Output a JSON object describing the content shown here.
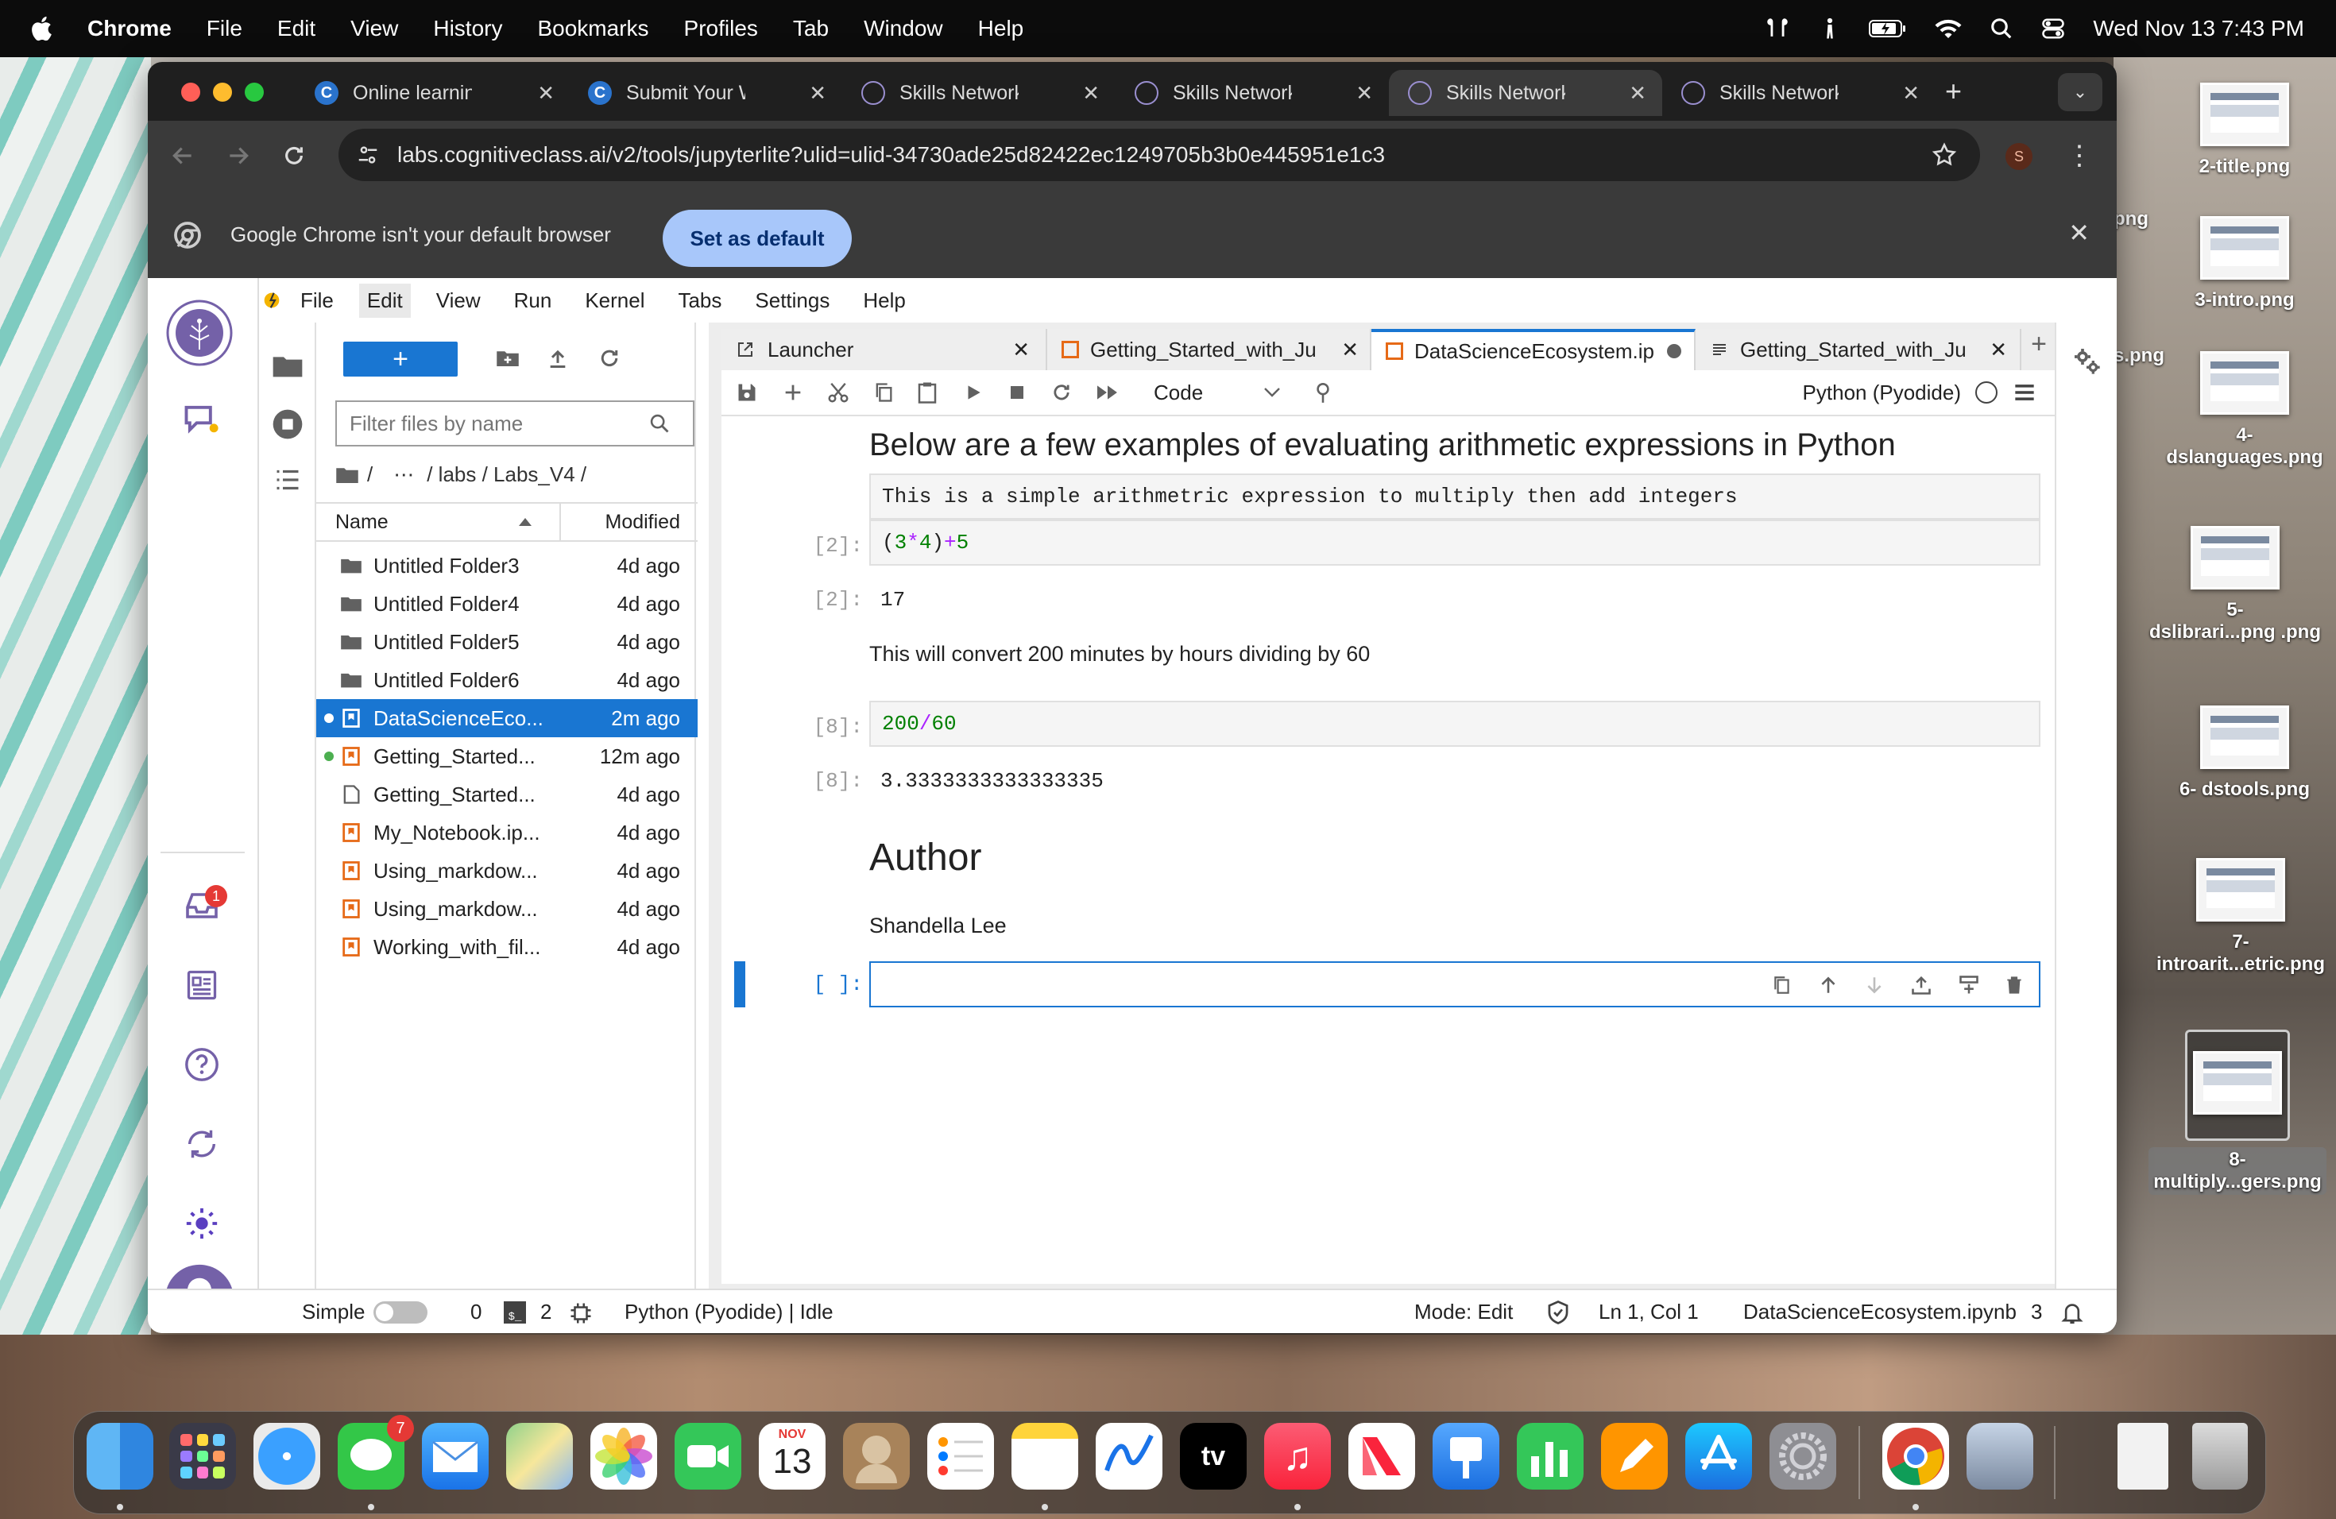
{
  "menubar": {
    "app": "Chrome",
    "items": [
      "File",
      "Edit",
      "View",
      "History",
      "Bookmarks",
      "Profiles",
      "Tab",
      "Window",
      "Help"
    ],
    "datetime": "Wed Nov 13  7:43 PM"
  },
  "browser": {
    "tabs": [
      {
        "title": "Online learning fo",
        "icon": "coursera-icon"
      },
      {
        "title": "Submit Your Work",
        "icon": "coursera-icon"
      },
      {
        "title": "Skills Network La",
        "icon": "skills-network-icon"
      },
      {
        "title": "Skills Network Ed",
        "icon": "skills-network-icon"
      },
      {
        "title": "Skills Network La",
        "icon": "skills-network-icon",
        "active": true
      },
      {
        "title": "Skills Network Ed",
        "icon": "skills-network-icon"
      }
    ],
    "url": "labs.cognitiveclass.ai/v2/tools/jupyterlite?ulid=ulid-34730ade25d82422ec1249705b3b0e445951e1c3",
    "profile_initial": "S",
    "infobar_text": "Google Chrome isn't your default browser",
    "infobar_button": "Set as default"
  },
  "jupyter": {
    "menu": [
      "File",
      "Edit",
      "View",
      "Run",
      "Kernel",
      "Tabs",
      "Settings",
      "Help"
    ],
    "inbox_badge": "1",
    "filter_placeholder": "Filter files by name",
    "breadcrumb": [
      "/",
      "⋯",
      "/ labs / Labs_V4 /"
    ],
    "columns": {
      "name": "Name",
      "modified": "Modified"
    },
    "files": [
      {
        "name": "Untitled Folder3",
        "modified": "4d ago",
        "type": "folder"
      },
      {
        "name": "Untitled Folder4",
        "modified": "4d ago",
        "type": "folder"
      },
      {
        "name": "Untitled Folder5",
        "modified": "4d ago",
        "type": "folder"
      },
      {
        "name": "Untitled Folder6",
        "modified": "4d ago",
        "type": "folder"
      },
      {
        "name": "DataScienceEco...",
        "modified": "2m ago",
        "type": "notebook",
        "selected": true,
        "running": true
      },
      {
        "name": "Getting_Started...",
        "modified": "12m ago",
        "type": "notebook",
        "running": true
      },
      {
        "name": "Getting_Started...",
        "modified": "4d ago",
        "type": "file"
      },
      {
        "name": "My_Notebook.ip...",
        "modified": "4d ago",
        "type": "notebook"
      },
      {
        "name": "Using_markdow...",
        "modified": "4d ago",
        "type": "notebook"
      },
      {
        "name": "Using_markdow...",
        "modified": "4d ago",
        "type": "notebook"
      },
      {
        "name": "Working_with_fil...",
        "modified": "4d ago",
        "type": "notebook"
      }
    ],
    "doc_tabs": [
      {
        "title": "Launcher"
      },
      {
        "title": "Getting_Started_with_Ju"
      },
      {
        "title": "DataScienceEcosystem.ip",
        "active": true
      },
      {
        "title": "Getting_Started_with_Ju"
      }
    ],
    "cell_type": "Code",
    "kernel": "Python (Pyodide)",
    "notebook": {
      "heading": "Below are a few examples of evaluating arithmetic expressions in Python",
      "raw_text": "This is a simple arithmetric expression to multiply then add integers",
      "cell1_prompt": "[2]:",
      "cell1_open": "(",
      "cell1_a": "3",
      "cell1_op": "*",
      "cell1_b": "4",
      "cell1_close": ")",
      "cell1_plus": "+",
      "cell1_c": "5",
      "out1_prompt": "[2]:",
      "out1": "17",
      "md2": "This will convert 200 minutes by hours dividing by 60",
      "cell2_prompt": "[8]:",
      "cell2_a": "200",
      "cell2_op": "/",
      "cell2_b": "60",
      "out2_prompt": "[8]:",
      "out2": "3.3333333333333335",
      "author_heading": "Author",
      "author_name": "Shandella Lee",
      "empty_prompt": "[ ]:"
    },
    "status": {
      "simple": "Simple",
      "terminals": "0",
      "kernels": "2",
      "kernel_state": "Python (Pyodide) | Idle",
      "mode": "Mode: Edit",
      "position": "Ln 1, Col 1",
      "file": "DataScienceEcosystem.ipynb",
      "count": "3"
    }
  },
  "desktop": {
    "files": [
      {
        "label": "2-title.png"
      },
      {
        "label": "3-intro.png"
      },
      {
        "label": "4-\ndslanguages.png"
      },
      {
        "label": "5-\ndslibrari...png .png"
      },
      {
        "label": "6- dstools.png"
      },
      {
        "label": "7-\nintroarit...etric.png"
      },
      {
        "label": "8-\nmultiply...gers.png"
      }
    ],
    "partial_labels": [
      "png",
      "s.png"
    ]
  },
  "dock": {
    "calendar_month": "NOV",
    "calendar_day": "13",
    "messages_badge": "7",
    "tv_label": "tv"
  },
  "colors": {
    "jupyter_blue": "#1976d2",
    "notebook_orange": "#e66a17",
    "chrome_dark": "#3a3a3a"
  }
}
